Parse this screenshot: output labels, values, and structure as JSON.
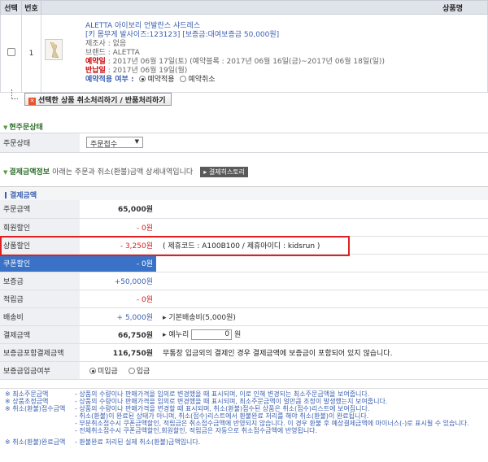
{
  "header": {
    "select": "선택",
    "num": "번호",
    "product": "상품명"
  },
  "product": {
    "row_no": "1",
    "name": "ALETTA 아이보리 언발란스 샤드레스",
    "sub": "[키 몸무게 발사이즈:123123] [보증금:대여보증금 50,000원]",
    "maker_label": "제조사 : 없음",
    "brand_label": "브랜드 : ALETTA",
    "reserve_day_label": "예약일",
    "reserve_day_value": ": 2017년 06월 17일(토)",
    "reserve_block": "(예약블록 : 2017년 06월 16일(금)~2017년 06월 18일(일))",
    "return_label": "반납일",
    "return_value": ": 2017년 06월 19일(월)",
    "reserve_apply_label": "예약적용 여부 :",
    "reserve_apply_on": "예약적용",
    "reserve_apply_off": "예약취소"
  },
  "action": {
    "cancel_return": "선택한 상품 취소처리하기 / 반품처리하기"
  },
  "status_section": {
    "title": "현주문상태",
    "label": "주문상태",
    "selected": "주문접수"
  },
  "payment_section": {
    "title": "결제금액정보",
    "desc": "아래는 주문과 취소(환불)금액 상세내역입니다",
    "history_btn": "결제히스토리",
    "box_title": "결제금액",
    "rows": {
      "order_amount": {
        "label": "주문금액",
        "value": "65,000원"
      },
      "member_discount": {
        "label": "회원할인",
        "value": "- 0원"
      },
      "product_discount": {
        "label": "상품할인",
        "value": "- 3,250원",
        "memo": "( 제휴코드 : A100B100 / 제휴아이디 : kidsrun )"
      },
      "coupon_discount": {
        "label": "쿠폰할인",
        "value": "- 0원"
      },
      "deposit": {
        "label": "보증금",
        "value": "+50,000원"
      },
      "points": {
        "label": "적립금",
        "value": "- 0원"
      },
      "shipping": {
        "label": "배송비",
        "value": "+ 5,000원",
        "memo": "기본배송비(5,000원)"
      },
      "payment": {
        "label": "결제금액",
        "value": "66,750원",
        "memo_prefix": "예누리",
        "input_value": "0",
        "memo_suffix": "원"
      },
      "deposit_total": {
        "label": "보증금포함결제금액",
        "value": "116,750원",
        "memo": "무통장 입금외의 결제인 경우 결제금액에 보증금이 포함되어 있지 않습니다."
      },
      "deposit_status": {
        "label": "보증금입금여부",
        "opt_no": "미입금",
        "opt_yes": "입금"
      }
    }
  },
  "notes": [
    {
      "label": "※ 최소주문금액",
      "text": "- 상품의 수량이나 판매가격을 임의로 변경했을 때 표시되며, 이로 인해 변경되는 최소주문금액을 보여줍니다."
    },
    {
      "label": "※ 상품조정금액",
      "text": "- 상품의 수량이나 판매가격을 임의로 변경했을 때 표시되며, 최소주문금액이 얼만큼 조정이 발생했는지 보여줍니다."
    },
    {
      "label": "※ 취소(환불)접수금액",
      "text": "- 상품의 수량이나 판매가격을 변경할 때 표시되며, 취소(환불)접수된 상품은 취소(접수)리스트에 보여집니다."
    },
    {
      "label": "",
      "text": "- 취소(환불)이 완료된 상태가 아니며, 취소(접수)리스트에서 환불완료 처리를 해야 취소(환불)이 완료됩니다."
    },
    {
      "label": "",
      "text": "- 부분취소접수시 쿠폰금액할인, 적립금은 취소접수금액에 반영되지 않습니다. 이 경우 환불 후 예상결제금액에 마이너스(-)로 표시될 수 있습니다."
    },
    {
      "label": "",
      "text": "- 전체취소접수시 쿠폰금액할인,회원할인, 적립금은 자동으로 취소접수금액에 반영됩니다."
    },
    {
      "label": "※ 취소(환불)완료금액",
      "text": "- 환불완료 처리된 실제 취소(환불)금액입니다."
    }
  ]
}
